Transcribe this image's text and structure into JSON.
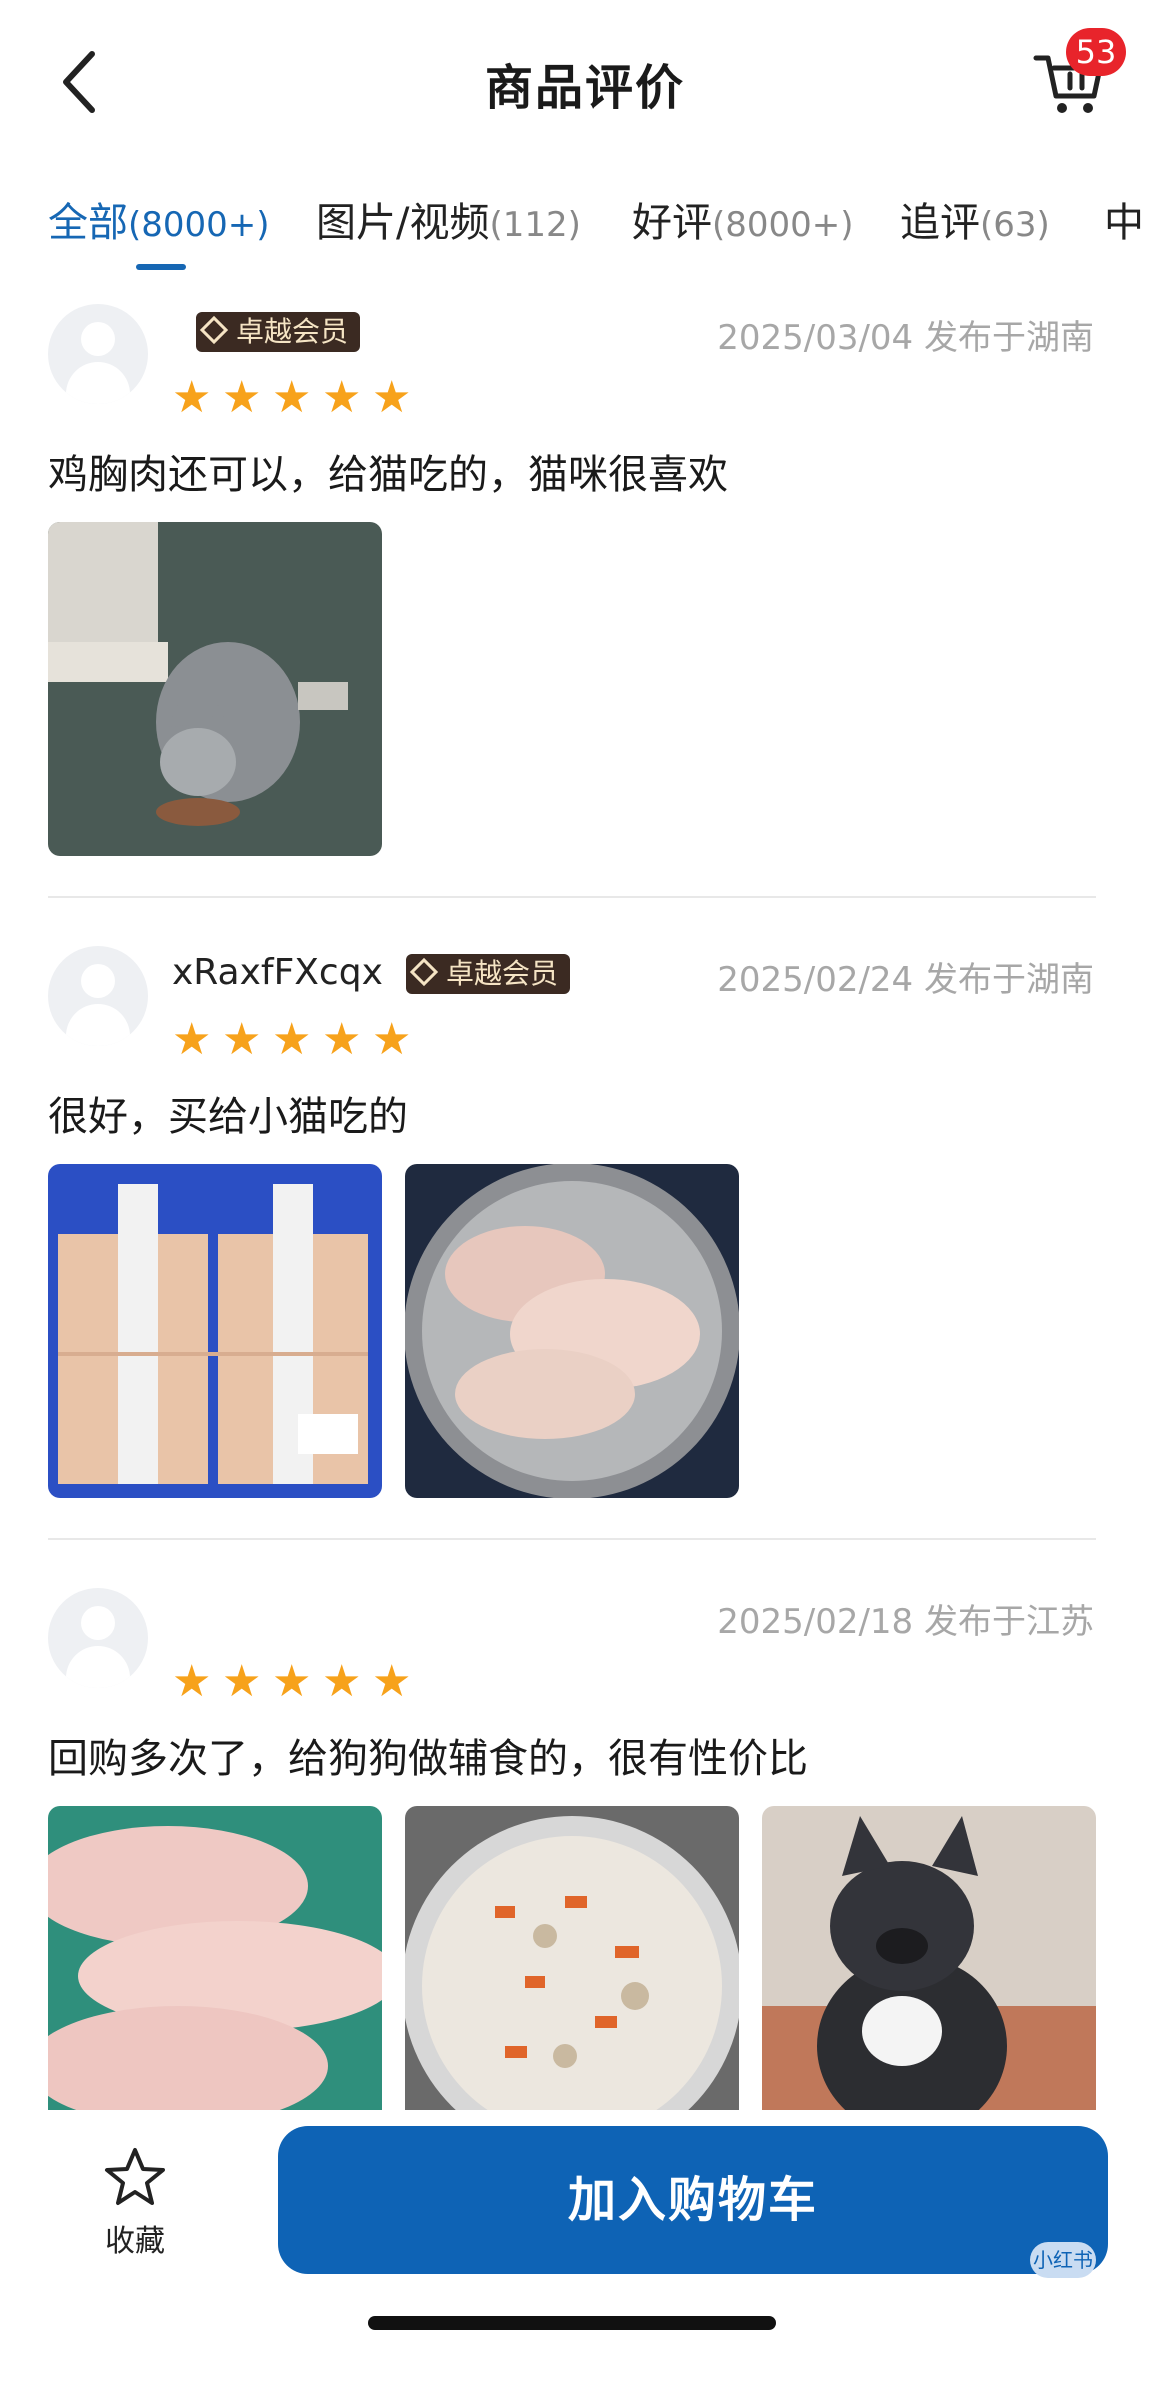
{
  "header": {
    "title": "商品评价",
    "cart_badge": "53"
  },
  "tabs": [
    {
      "label": "全部",
      "count": "(8000+)",
      "active": true
    },
    {
      "label": "图片/视频",
      "count": "(112)",
      "active": false
    },
    {
      "label": "好评",
      "count": "(8000+)",
      "active": false
    },
    {
      "label": "追评",
      "count": "(63)",
      "active": false
    },
    {
      "label": "中",
      "count": "",
      "active": false
    }
  ],
  "reviews": [
    {
      "username": "",
      "member_badge": "卓越会员",
      "date_location": "2025/03/04 发布于湖南",
      "rating": 5,
      "text": "鸡胸肉还可以，给猫吃的，猫咪很喜欢",
      "photos": [
        "cat-eating-photo"
      ]
    },
    {
      "username": "xRaxfFXcqx",
      "member_badge": "卓越会员",
      "date_location": "2025/02/24 发布于湖南",
      "rating": 5,
      "text": "很好，买给小猫吃的",
      "photos": [
        "packaged-chicken-breast-photo",
        "chicken-breast-bowl-photo"
      ]
    },
    {
      "username": "",
      "member_badge": "",
      "date_location": "2025/02/18 发布于江苏",
      "rating": 5,
      "text": "回购多次了，给狗狗做辅食的，很有性价比",
      "photos": [
        "raw-chicken-slices-photo",
        "dog-food-bowl-photo",
        "french-bulldog-photo"
      ]
    }
  ],
  "bottom_bar": {
    "favorite_label": "收藏",
    "add_to_cart_label": "加入购物车",
    "watermark": "小红书"
  },
  "colors": {
    "accent": "#1667b4",
    "star": "#f7a21b",
    "badge_red": "#e8242b",
    "button_blue": "#0e63b5"
  }
}
